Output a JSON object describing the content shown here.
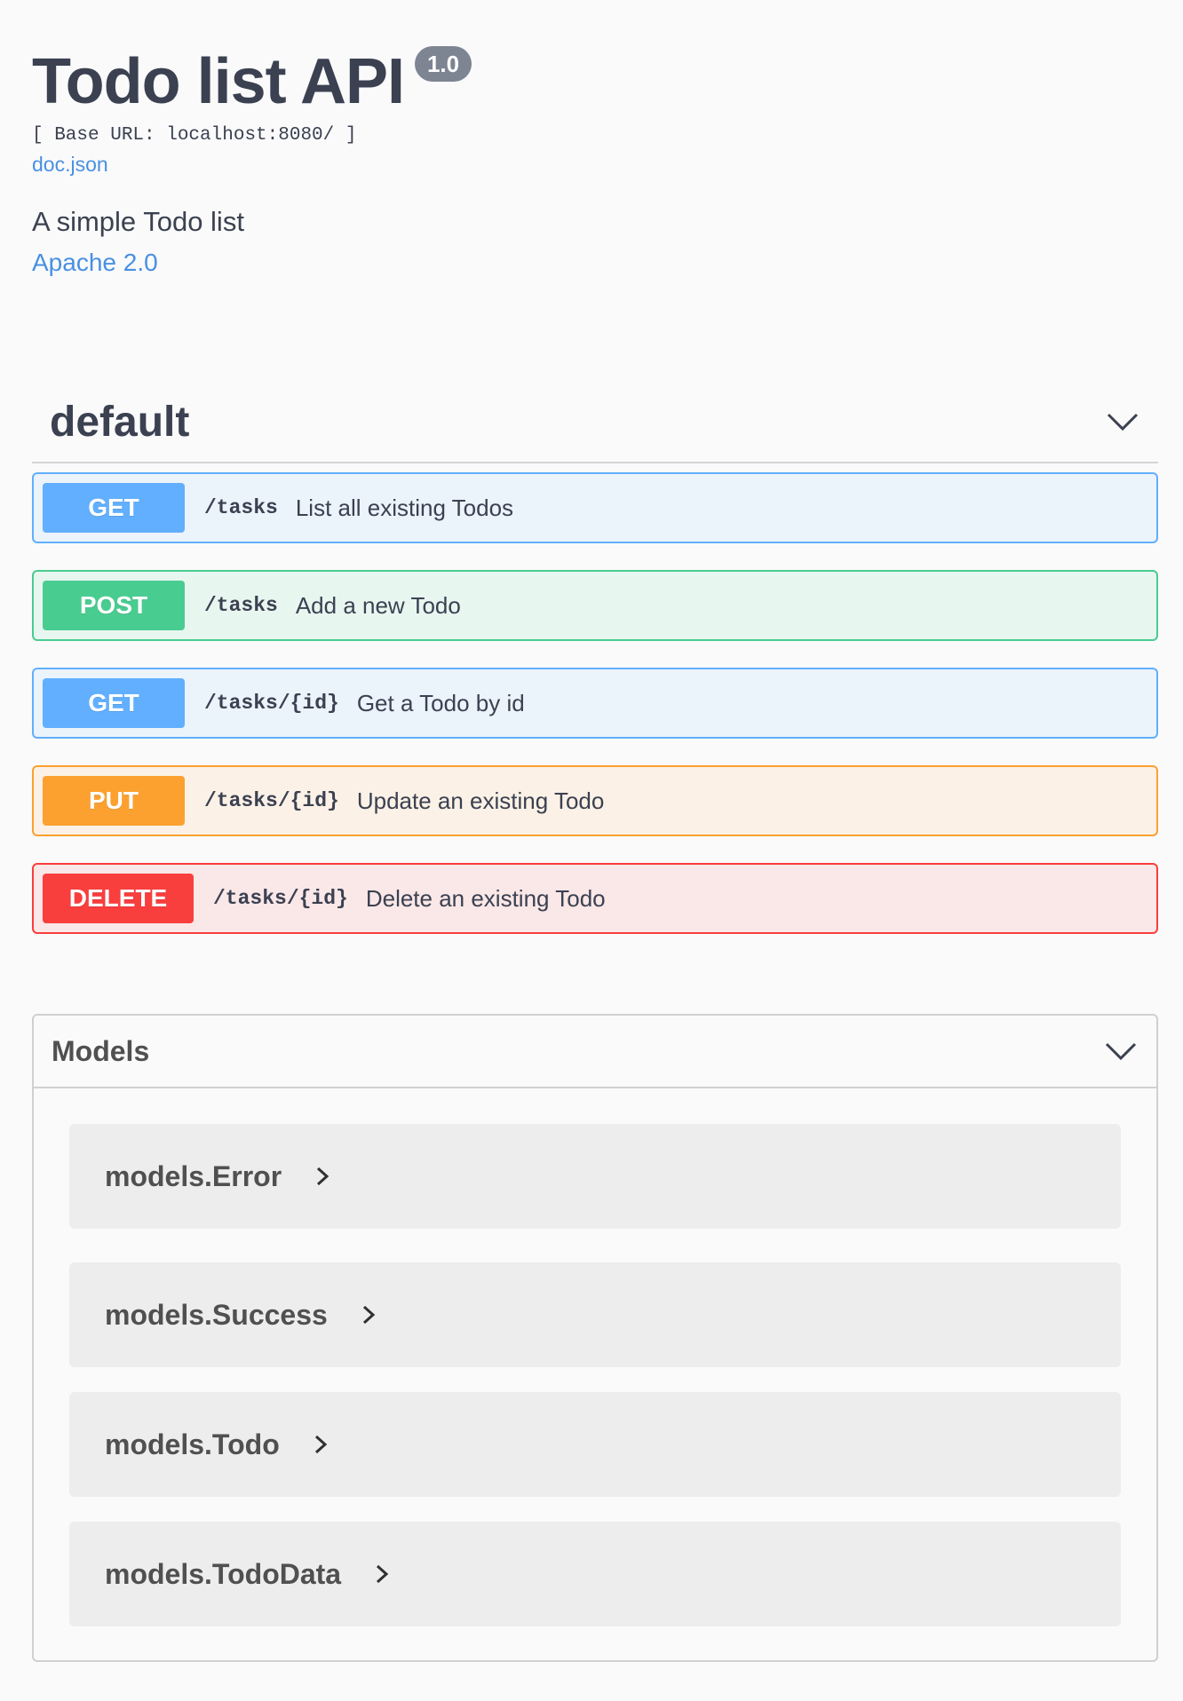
{
  "info": {
    "title": "Todo list API",
    "version": "1.0",
    "base_url": "[ Base URL: localhost:8080/ ]",
    "doc_link": "doc.json",
    "description": "A simple Todo list",
    "license": "Apache 2.0"
  },
  "tag": {
    "name": "default",
    "operations": [
      {
        "method": "GET",
        "path": "/tasks",
        "summary": "List all existing Todos"
      },
      {
        "method": "POST",
        "path": "/tasks",
        "summary": "Add a new Todo"
      },
      {
        "method": "GET",
        "path": "/tasks/{id}",
        "summary": "Get a Todo by id"
      },
      {
        "method": "PUT",
        "path": "/tasks/{id}",
        "summary": "Update an existing Todo"
      },
      {
        "method": "DELETE",
        "path": "/tasks/{id}",
        "summary": "Delete an existing Todo"
      }
    ]
  },
  "models": {
    "title": "Models",
    "items": [
      {
        "name": "models.Error"
      },
      {
        "name": "models.Success"
      },
      {
        "name": "models.Todo"
      },
      {
        "name": "models.TodoData"
      }
    ]
  },
  "colors": {
    "get": "#61affe",
    "post": "#49cc90",
    "put": "#fca130",
    "delete": "#f93e3e",
    "link": "#4990e2"
  },
  "icons": {
    "section_toggle": "chevron-down-icon",
    "model_expand": "chevron-right-icon"
  }
}
